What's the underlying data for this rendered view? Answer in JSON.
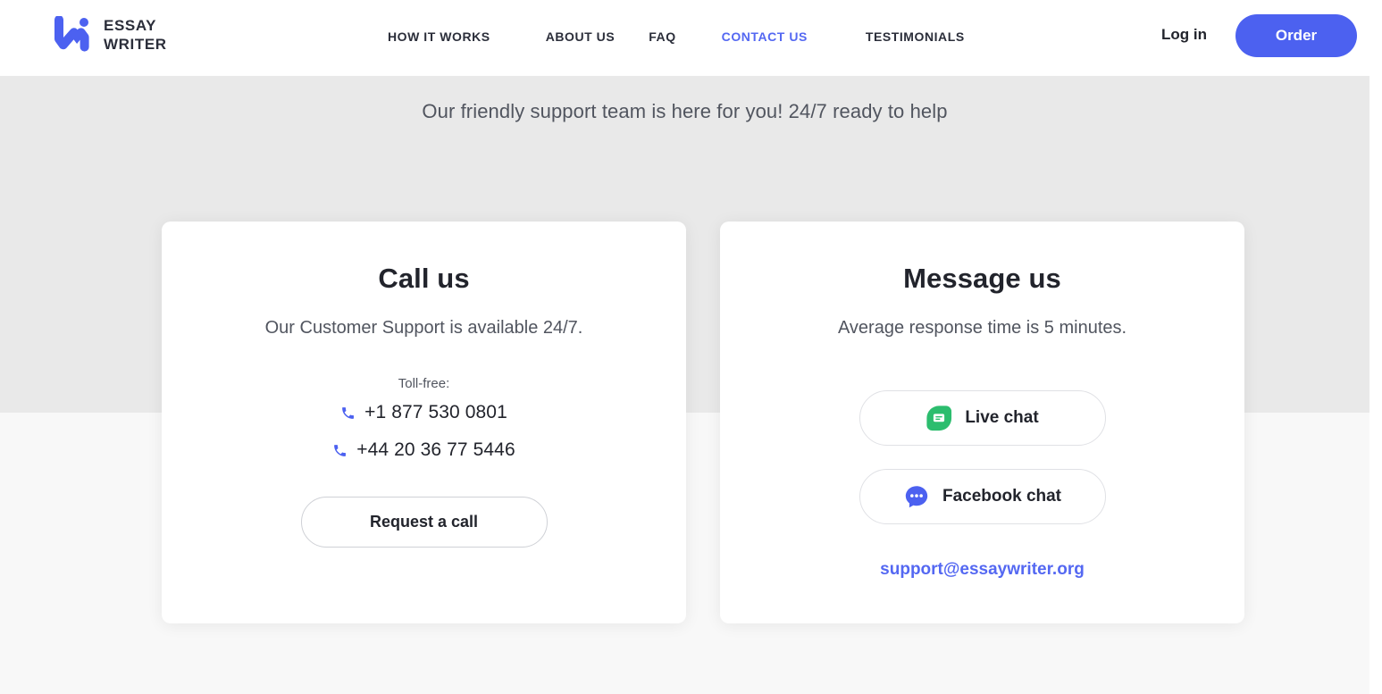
{
  "header": {
    "logo": {
      "icon": "essaywriter-w-logo-icon",
      "line1": "ESSAY",
      "line2": "WRITER"
    },
    "nav": [
      {
        "label": "HOW IT WORKS",
        "active": false
      },
      {
        "label": "ABOUT US",
        "active": false
      },
      {
        "label": "FAQ",
        "active": false
      },
      {
        "label": "CONTACT US",
        "active": true
      },
      {
        "label": "TESTIMONIALS",
        "active": false
      }
    ],
    "login_label": "Log in",
    "order_label": "Order",
    "accent_color": "#4c61f0",
    "active_nav_color": "#5468f2"
  },
  "hero": {
    "tagline": "Our friendly support team is here for you! 24/7 ready to help"
  },
  "call_card": {
    "title": "Call us",
    "subtitle": "Our Customer Support is available 24/7.",
    "tollfree_label": "Toll-free:",
    "phones": [
      {
        "icon": "phone-icon",
        "number": "+1 877 530 0801"
      },
      {
        "icon": "phone-icon",
        "number": "+44 20 36 77 5446"
      }
    ],
    "request_button": "Request a call"
  },
  "message_card": {
    "title": "Message us",
    "subtitle": "Average response time is 5 minutes.",
    "buttons": [
      {
        "icon": "live-chat-icon",
        "label": "Live chat",
        "icon_color": "#2cbd6e"
      },
      {
        "icon": "facebook-messenger-icon",
        "label": "Facebook chat",
        "icon_color": "#4c61f0"
      }
    ],
    "email": "support@essaywriter.org"
  }
}
